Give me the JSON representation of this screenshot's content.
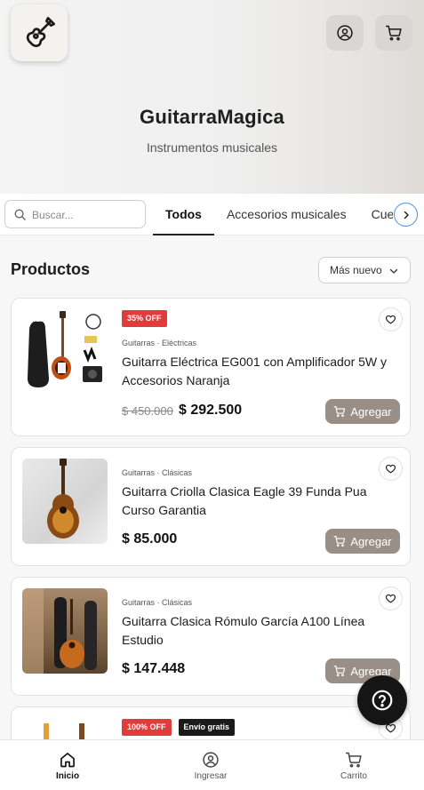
{
  "header": {
    "brand": "GuitarraMagica",
    "tagline": "Instrumentos musicales",
    "icons": {
      "logo": "guitar-icon",
      "account": "user-circle-icon",
      "cart": "cart-icon"
    }
  },
  "search": {
    "placeholder": "Buscar..."
  },
  "tabs": [
    {
      "label": "Todos",
      "active": true
    },
    {
      "label": "Accesorios musicales",
      "active": false
    },
    {
      "label": "Cuerdas",
      "active": false
    }
  ],
  "section": {
    "title": "Productos",
    "sort_label": "Más nuevo"
  },
  "products": [
    {
      "badges": [
        "35% OFF"
      ],
      "category": "Guitarras · Eléctricas",
      "name": "Guitarra Eléctrica EG001 con Amplificador 5W y Accesorios Naranja",
      "old_price": "$ 450.000",
      "price": "$ 292.500",
      "button": "Agregar"
    },
    {
      "badges": [],
      "category": "Guitarras · Clásicas",
      "name": "Guitarra Criolla Clasica Eagle 39 Funda Pua Curso Garantia",
      "old_price": "",
      "price": "$ 85.000",
      "button": "Agregar"
    },
    {
      "badges": [],
      "category": "Guitarras · Clásicas",
      "name": "Guitarra Clasica Rómulo García A100 Línea Estudio",
      "old_price": "",
      "price": "$ 147.448",
      "button": "Agregar"
    },
    {
      "badges": [
        "100% OFF",
        "Envío gratis"
      ],
      "category": "",
      "name": "",
      "old_price": "",
      "price": "",
      "button": ""
    }
  ],
  "bottom_nav": [
    {
      "label": "Inicio",
      "icon": "home-icon",
      "active": true
    },
    {
      "label": "Ingresar",
      "icon": "user-circle-icon",
      "active": false
    },
    {
      "label": "Carrito",
      "icon": "cart-icon",
      "active": false
    }
  ],
  "colors": {
    "discount": "#e23b3b",
    "shipping": "#1a1a1a",
    "add_button": "#9a8f87",
    "accent_blue": "#4a90d9"
  }
}
